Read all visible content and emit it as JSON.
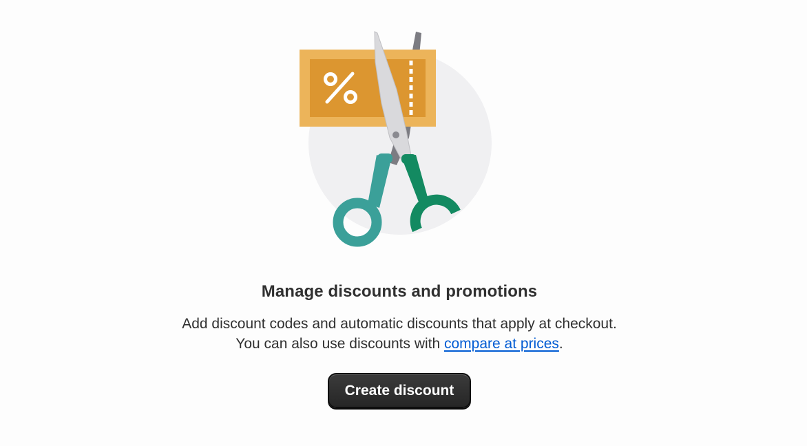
{
  "empty_state": {
    "illustration": "discount-coupon-scissors-illustration",
    "coupon_symbol": "%",
    "heading": "Manage discounts and promotions",
    "body_line1": "Add discount codes and automatic discounts that apply at checkout.",
    "body_line2_prefix": "You can also use discounts with ",
    "body_link": "compare at prices",
    "body_line2_suffix": ".",
    "primary_button": "Create discount"
  },
  "colors": {
    "coupon_outer": "#ecb45a",
    "coupon_inner": "#dc9630",
    "circle_bg": "#f0f0f2",
    "scissor_blade": "#d9d9dc",
    "scissor_back_blade": "#7c7c82",
    "handle_left": "#3ba099",
    "handle_right": "#138a61",
    "link": "#005bd3",
    "button_bg": "#303030"
  }
}
